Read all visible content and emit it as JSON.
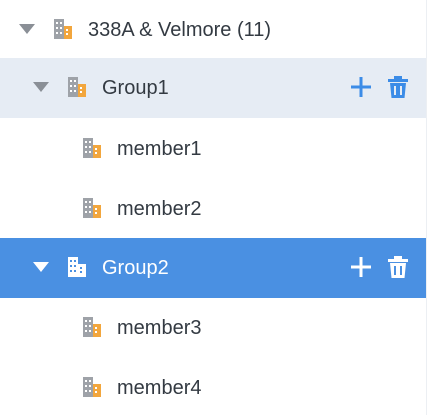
{
  "tree": {
    "root": {
      "label": "338A & Velmore (11)",
      "expanded": true
    },
    "groups": [
      {
        "label": "Group1",
        "expanded": true,
        "state": "hover",
        "members": [
          {
            "label": "member1"
          },
          {
            "label": "member2"
          }
        ]
      },
      {
        "label": "Group2",
        "expanded": true,
        "state": "selected",
        "members": [
          {
            "label": "member3"
          },
          {
            "label": "member4"
          }
        ]
      }
    ],
    "icons": {
      "expand": "caret-down-icon",
      "node": "building-icon",
      "add": "plus-icon",
      "delete": "trash-icon"
    },
    "colors": {
      "hover_bg": "#e6ecf4",
      "selected_bg": "#4a90e2",
      "accent": "#3c8ce7",
      "text": "#333a42",
      "caret": "#8a8f96",
      "building_orange": "#f2a63d",
      "building_gray": "#9ea2a8"
    }
  }
}
